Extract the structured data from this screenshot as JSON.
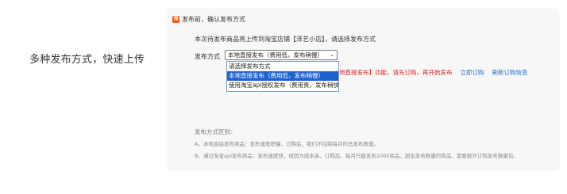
{
  "caption": "多种发布方式，快速上传",
  "dialog": {
    "logo_icon": "taobao-logo-icon",
    "title": "发布前，确认发布方式",
    "intro": "本次待发布商品将上传到淘宝店铺【泽艺小店】，请选择发布方式",
    "method_label": "发布方式",
    "selected_value": "本地直接发布（费用低，发布稍慢）",
    "options": [
      "请选择发布方式",
      "本地直接发布（费用低，发布稍慢）",
      "使用淘宝api授权发布（费用贵，发布稍快）"
    ],
    "notice": {
      "text": "您还未订购【本地直接发布】功能，请先订购，再开始发布",
      "visible_text": "地直接发布】功能，请先订购，再开始发布",
      "links": [
        "立即订购",
        "刷新订购信息"
      ]
    },
    "notes_title": "发布方式区别：",
    "notes": [
      "A、本地直接发布商品：发布速度稍慢，订购后，我们不控制每月的总发布数量。",
      "B、通过淘宝api发布商品：发布速度快，但因为成本高，订购后，每月只能发布2000商品，超出发布数量的商品，需要额外订购发布数量包。"
    ]
  },
  "colors": {
    "accent": "#ff5a00",
    "selection": "#1e62d0",
    "notice": "#e02020",
    "link": "#1e6fd0"
  }
}
